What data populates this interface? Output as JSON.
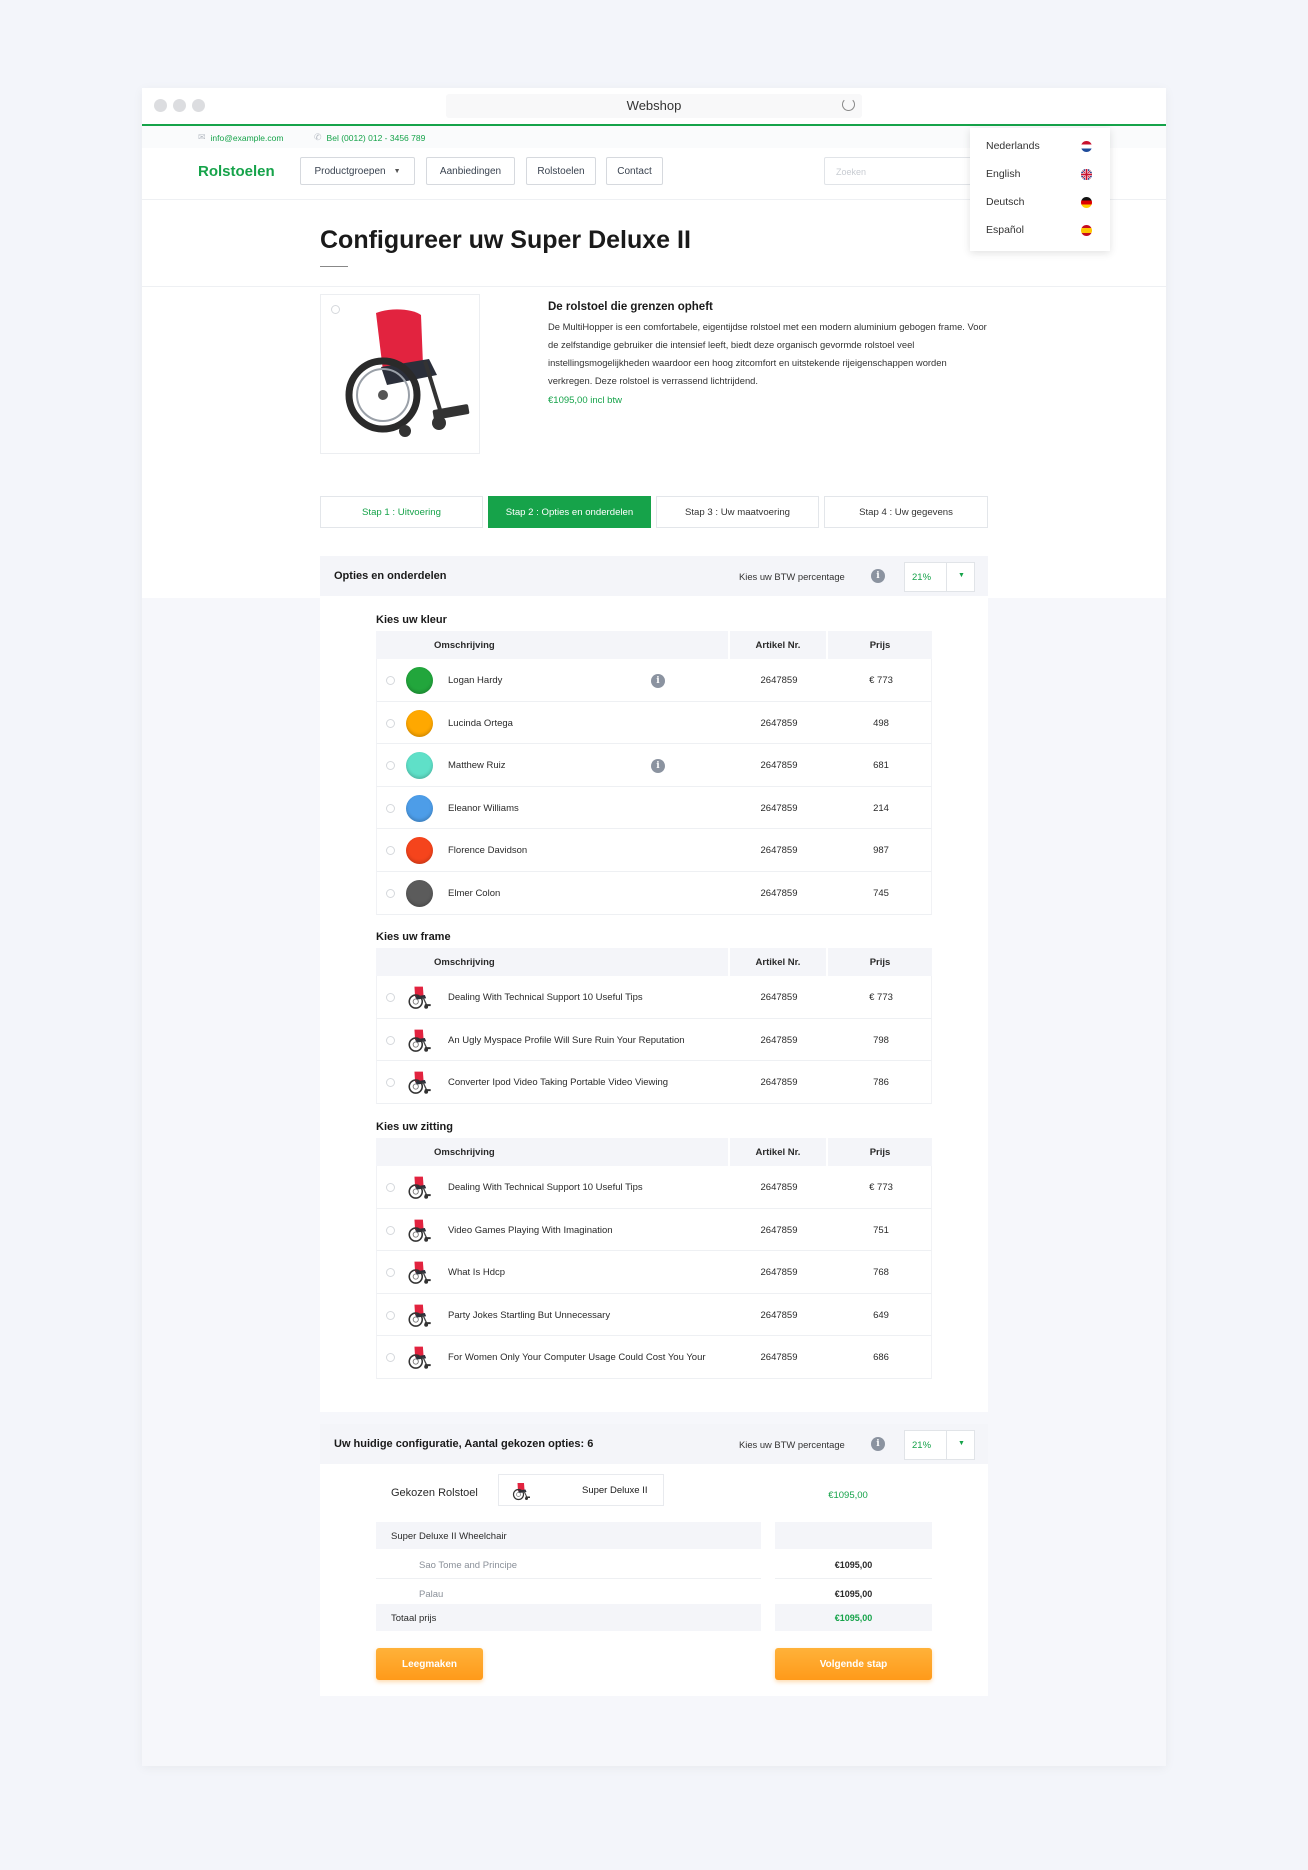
{
  "browser": {
    "title": "Webshop"
  },
  "topbar": {
    "email": "info@example.com",
    "phone": "Bel (0012) 012 - 3456 789"
  },
  "nav": {
    "logo": "Rolstoelen",
    "items": [
      "Productgroepen",
      "Aanbiedingen",
      "Rolstoelen",
      "Contact"
    ],
    "search_placeholder": "Zoeken"
  },
  "languages": [
    {
      "label": "Nederlands",
      "flag": "nl-flag-icon"
    },
    {
      "label": "English",
      "flag": "uk-flag-icon"
    },
    {
      "label": "Deutsch",
      "flag": "de-flag-icon"
    },
    {
      "label": "Español",
      "flag": "es-flag-icon"
    }
  ],
  "page": {
    "title": "Configureer uw Super Deluxe II"
  },
  "product": {
    "heading": "De rolstoel die grenzen opheft",
    "description": "De MultiHopper is een comfortabele, eigentijdse rolstoel met een modern aluminium gebogen frame. Voor de zelfstandige gebruiker die intensief leeft, biedt deze organisch gevormde rolstoel veel instellingsmogelijkheden waardoor een hoog zitcomfort en uitstekende rijeigenschappen worden verkregen. Deze rolstoel is verrassend lichtrijdend.",
    "price": "€1095,00 incl btw"
  },
  "steps": [
    "Stap 1 : Uitvoering",
    "Stap 2 : Opties en onderdelen",
    "Stap 3 : Uw maatvoering",
    "Stap 4 : Uw gegevens"
  ],
  "options_panel": {
    "title": "Opties en onderdelen",
    "btw_label": "Kies uw BTW percentage",
    "btw_value": "21%",
    "columns": {
      "desc": "Omschrijving",
      "art": "Artikel Nr.",
      "price": "Prijs"
    },
    "colors": {
      "title": "Kies uw kleur",
      "rows": [
        {
          "name": "Logan Hardy",
          "art": "2647859",
          "price": "€ 773",
          "color": "#22a63c",
          "info": true
        },
        {
          "name": "Lucinda Ortega",
          "art": "2647859",
          "price": "498",
          "color": "#ffa800",
          "info": false
        },
        {
          "name": "Matthew Ruiz",
          "art": "2647859",
          "price": "681",
          "color": "#5fe0c8",
          "info": true
        },
        {
          "name": "Eleanor Williams",
          "art": "2647859",
          "price": "214",
          "color": "#4d9de8",
          "info": false
        },
        {
          "name": "Florence Davidson",
          "art": "2647859",
          "price": "987",
          "color": "#f5441c",
          "info": false
        },
        {
          "name": "Elmer Colon",
          "art": "2647859",
          "price": "745",
          "color": "#5b5b5b",
          "info": false
        }
      ]
    },
    "frame": {
      "title": "Kies uw frame",
      "rows": [
        {
          "name": "Dealing With Technical Support 10 Useful Tips",
          "art": "2647859",
          "price": "€ 773"
        },
        {
          "name": "An Ugly Myspace Profile Will Sure Ruin Your Reputation",
          "art": "2647859",
          "price": "798"
        },
        {
          "name": "Converter Ipod Video Taking Portable Video Viewing",
          "art": "2647859",
          "price": "786"
        }
      ]
    },
    "seat": {
      "title": "Kies uw zitting",
      "rows": [
        {
          "name": "Dealing With Technical Support 10 Useful Tips",
          "art": "2647859",
          "price": "€ 773"
        },
        {
          "name": "Video Games Playing With Imagination",
          "art": "2647859",
          "price": "751"
        },
        {
          "name": "What Is Hdcp",
          "art": "2647859",
          "price": "768"
        },
        {
          "name": "Party Jokes Startling But Unnecessary",
          "art": "2647859",
          "price": "649"
        },
        {
          "name": "For Women Only Your Computer Usage Could Cost You Your",
          "art": "2647859",
          "price": "686"
        }
      ]
    }
  },
  "config_panel": {
    "title": "Uw huidige configuratie, Aantal gekozen opties: 6",
    "btw_label": "Kies uw BTW percentage",
    "btw_value": "21%",
    "chosen_label": "Gekozen Rolstoel",
    "chosen_name": "Super Deluxe II",
    "chosen_price": "€1095,00",
    "group_title": "Super Deluxe II Wheelchair",
    "lines": [
      {
        "name": "Sao Tome and Principe",
        "price": "€1095,00"
      },
      {
        "name": "Palau",
        "price": "€1095,00"
      }
    ],
    "total_label": "Totaal prijs",
    "total_price": "€1095,00",
    "clear_button": "Leegmaken",
    "next_button": "Volgende stap"
  },
  "colors": {
    "accent": "#16a34a",
    "orange": "#ff9f1c"
  }
}
